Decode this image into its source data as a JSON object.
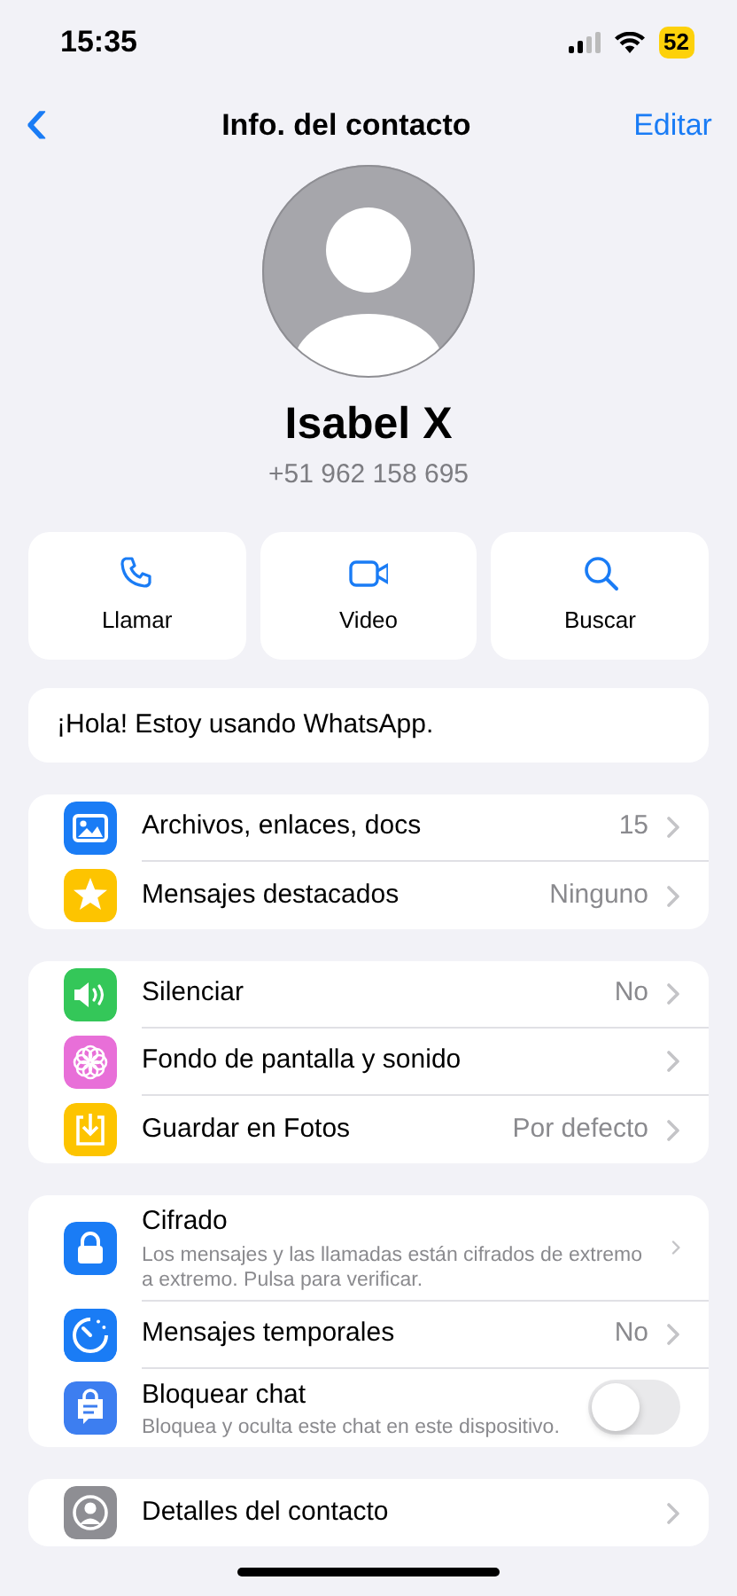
{
  "status_bar": {
    "time": "15:35",
    "battery": "52"
  },
  "nav": {
    "back": "‹",
    "title": "Info. del contacto",
    "action": "Editar"
  },
  "contact": {
    "name": "Isabel X",
    "phone": "+51 962 158 695"
  },
  "actions": [
    {
      "label": "Llamar"
    },
    {
      "label": "Video"
    },
    {
      "label": "Buscar"
    }
  ],
  "about": "¡Hola! Estoy usando WhatsApp.",
  "groups": [
    {
      "rows": [
        {
          "kind": "link",
          "label": "Archivos, enlaces, docs",
          "value": "15",
          "color": "#1a7cf5"
        },
        {
          "kind": "link",
          "label": "Mensajes destacados",
          "value": "Ninguno",
          "color": "#fdc400"
        }
      ]
    },
    {
      "rows": [
        {
          "kind": "link",
          "label": "Silenciar",
          "value": "No",
          "color": "#34c759"
        },
        {
          "kind": "link",
          "label": "Fondo de pantalla y sonido",
          "color": "#e86fd8"
        },
        {
          "kind": "link",
          "label": "Guardar en Fotos",
          "value": "Por defecto",
          "color": "#fdc400"
        }
      ]
    },
    {
      "rows": [
        {
          "kind": "link",
          "label": "Cifrado",
          "subtitle": "Los mensajes y las llamadas están cifrados de extremo a extremo. Pulsa para verificar.",
          "color": "#1a7cf5"
        },
        {
          "kind": "link",
          "label": "Mensajes temporales",
          "value": "No",
          "color": "#1a7cf5"
        },
        {
          "kind": "toggle",
          "label": "Bloquear chat",
          "subtitle": "Bloquea y oculta este chat en este dispositivo.",
          "on": false,
          "color": "#3d7ef0"
        }
      ]
    },
    {
      "rows": [
        {
          "kind": "link",
          "label": "Detalles del contacto",
          "color": "#8e8e93"
        }
      ]
    }
  ]
}
